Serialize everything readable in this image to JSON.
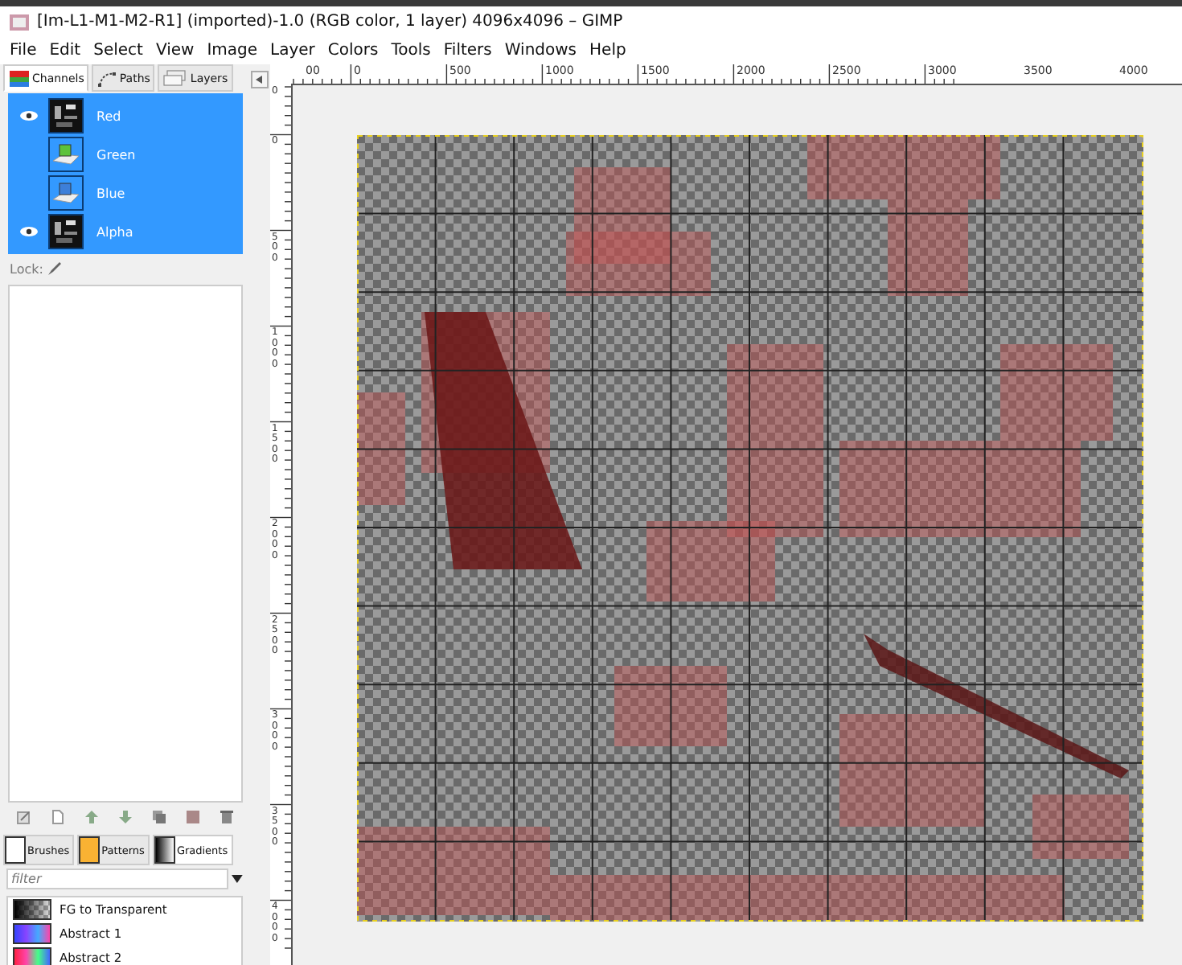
{
  "window": {
    "title": "[Im-L1-M1-M2-R1] (imported)-1.0 (RGB color, 1 layer) 4096x4096 – GIMP"
  },
  "menu": [
    "File",
    "Edit",
    "Select",
    "View",
    "Image",
    "Layer",
    "Colors",
    "Tools",
    "Filters",
    "Windows",
    "Help"
  ],
  "dock_tabs": [
    {
      "label": "Channels",
      "kind": "channels",
      "selected": true
    },
    {
      "label": "Paths",
      "kind": "paths",
      "selected": false
    },
    {
      "label": "Layers",
      "kind": "layers",
      "selected": false
    }
  ],
  "channels": [
    {
      "name": "Red",
      "visible": true,
      "kind": "image",
      "selected": true
    },
    {
      "name": "Green",
      "visible": false,
      "kind": "green",
      "selected": true
    },
    {
      "name": "Blue",
      "visible": false,
      "kind": "blue",
      "selected": true
    },
    {
      "name": "Alpha",
      "visible": true,
      "kind": "alpha",
      "selected": true
    }
  ],
  "lock_label": "Lock:",
  "resource_tabs": [
    {
      "label": "Brushes",
      "kind": "brushes",
      "selected": false
    },
    {
      "label": "Patterns",
      "kind": "patterns",
      "selected": false
    },
    {
      "label": "Gradients",
      "kind": "gradients",
      "selected": true
    }
  ],
  "filter": {
    "placeholder": "filter"
  },
  "gradients": [
    {
      "name": "FG to Transparent",
      "kind": "fg"
    },
    {
      "name": "Abstract 1",
      "kind": "abstract1"
    },
    {
      "name": "Abstract 2",
      "kind": "abstract2"
    }
  ],
  "hruler": [
    "00",
    "0",
    "500",
    "1000",
    "1500",
    "2000",
    "2500",
    "3000",
    "3500",
    "4000"
  ],
  "vruler": [
    "0",
    "0",
    "500",
    "1000",
    "1500",
    "2000",
    "2500",
    "3000",
    "3500",
    "4000"
  ]
}
